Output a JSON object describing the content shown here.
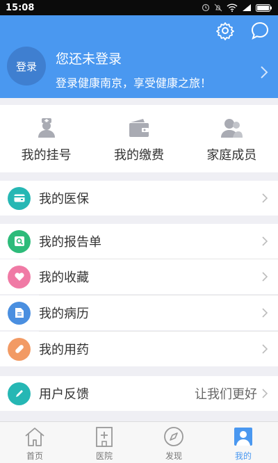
{
  "status_bar": {
    "time": "15:08"
  },
  "header": {
    "avatar_label": "登录",
    "title": "您还未登录",
    "subtitle": "登录健康南京，享受健康之旅！"
  },
  "quick_actions": [
    {
      "label": "我的挂号",
      "icon": "nurse-icon"
    },
    {
      "label": "我的缴费",
      "icon": "wallet-icon"
    },
    {
      "label": "家庭成员",
      "icon": "family-icon"
    }
  ],
  "menu": {
    "insurance": {
      "label": "我的医保",
      "icon": "card-icon",
      "color": "#26b7b4"
    },
    "report": {
      "label": "我的报告单",
      "icon": "report-icon",
      "color": "#2dbb7a"
    },
    "favorites": {
      "label": "我的收藏",
      "icon": "heart-icon",
      "color": "#f07aa5"
    },
    "records": {
      "label": "我的病历",
      "icon": "document-icon",
      "color": "#4a8fe0"
    },
    "medication": {
      "label": "我的用药",
      "icon": "pill-icon",
      "color": "#f29a64"
    },
    "feedback": {
      "label": "用户反馈",
      "extra": "让我们更好",
      "icon": "pencil-icon",
      "color": "#26b7b4"
    }
  },
  "tabs": [
    {
      "label": "首页",
      "icon": "home-icon"
    },
    {
      "label": "医院",
      "icon": "hospital-icon"
    },
    {
      "label": "发现",
      "icon": "compass-icon"
    },
    {
      "label": "我的",
      "icon": "profile-icon",
      "active": true
    }
  ],
  "colors": {
    "primary": "#4a98f0",
    "background": "#efeff4"
  }
}
